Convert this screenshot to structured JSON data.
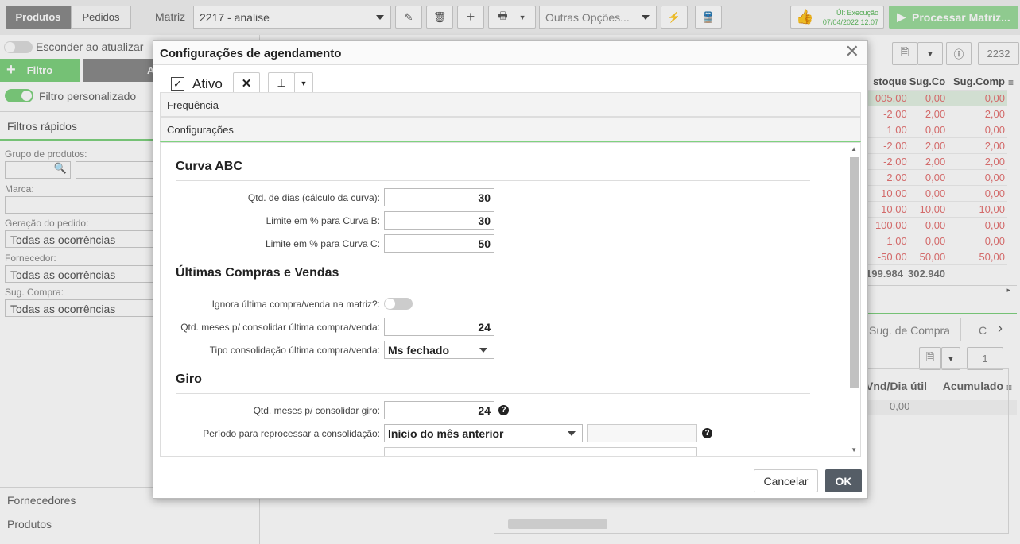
{
  "topbar": {
    "tabs": [
      "Produtos",
      "Pedidos"
    ],
    "matriz_label": "Matriz",
    "matriz_value": "2217 - analise",
    "outras_opcoes": "Outras Opções...",
    "ult_execucao_label": "Últ Execução",
    "ult_execucao_value": "07/04/2022 12:07",
    "processar_label": "Processar Matriz..."
  },
  "left": {
    "esconder_label": "Esconder ao atualizar",
    "filtro_button": "Filtro",
    "second_button": "A",
    "filtro_personalizado": "Filtro personalizado",
    "filtros_rapidos": "Filtros rápidos",
    "grupo_label": "Grupo de produtos:",
    "marca_label": "Marca:",
    "geracao_label": "Geração do pedido:",
    "geracao_value": "Todas as ocorrências",
    "fornecedor_label": "Fornecedor:",
    "fornecedor_value": "Todas as ocorrências",
    "sug_compra_label": "Sug. Compra:",
    "sug_compra_value": "Todas as ocorrências",
    "fornecedores": "Fornecedores",
    "produtos": "Produtos"
  },
  "right": {
    "counter": "2232",
    "headers": [
      "stoque",
      "Sug.Co",
      "Sug.Comp"
    ],
    "rows": [
      [
        "005,00",
        "0,00",
        "0,00"
      ],
      [
        "-2,00",
        "2,00",
        "2,00"
      ],
      [
        "1,00",
        "0,00",
        "0,00"
      ],
      [
        "-2,00",
        "2,00",
        "2,00"
      ],
      [
        "-2,00",
        "2,00",
        "2,00"
      ],
      [
        "2,00",
        "0,00",
        "0,00"
      ],
      [
        "10,00",
        "0,00",
        "0,00"
      ],
      [
        "-10,00",
        "10,00",
        "10,00"
      ],
      [
        "100,00",
        "0,00",
        "0,00"
      ],
      [
        "1,00",
        "0,00",
        "0,00"
      ],
      [
        "-50,00",
        "50,00",
        "50,00"
      ]
    ],
    "totals": [
      "199.984",
      "302.940"
    ],
    "tab_sug_compra": "Sug. de Compra",
    "tab_c": "C",
    "counter2": "1",
    "headers2": [
      "Vnd/Dia útil",
      "Acumulado"
    ],
    "row2": "0,00"
  },
  "modal": {
    "title": "Configurações de agendamento",
    "ativo_label": "Ativo",
    "frequencia": "Frequência",
    "configuracoes": "Configurações",
    "curva_abc": "Curva ABC",
    "qtd_dias_label": "Qtd. de dias (cálculo da curva):",
    "qtd_dias_value": "30",
    "limite_b_label": "Limite em % para Curva B:",
    "limite_b_value": "30",
    "limite_c_label": "Limite em % para Curva C:",
    "limite_c_value": "50",
    "ultimas_title": "Últimas Compras e Vendas",
    "ignora_label": "Ignora última compra/venda na matriz?:",
    "qtd_meses_ult_label": "Qtd. meses p/ consolidar última compra/venda:",
    "qtd_meses_ult_value": "24",
    "tipo_consol_label": "Tipo consolidação última compra/venda:",
    "tipo_consol_value": "Ms fechado",
    "giro_title": "Giro",
    "qtd_meses_giro_label": "Qtd. meses p/ consolidar giro:",
    "qtd_meses_giro_value": "24",
    "periodo_label": "Período para reprocessar a consolidação:",
    "periodo_value": "Início do mês anterior",
    "cancelar": "Cancelar",
    "ok": "OK"
  }
}
